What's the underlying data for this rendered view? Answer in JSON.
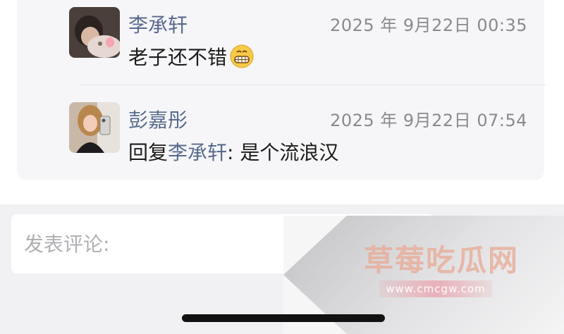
{
  "comments": [
    {
      "author": "李承轩",
      "timestamp": "2025 年 9月22日 00:35",
      "text": "老子还不错",
      "emoji": "grinning-face-icon"
    },
    {
      "author": "彭嘉彤",
      "timestamp": "2025 年 9月22日 07:54",
      "reply_prefix": "回复",
      "reply_to": "李承轩",
      "reply_separator": ": ",
      "text": "是个流浪汉"
    }
  ],
  "composer": {
    "placeholder": "发表评论:"
  },
  "watermark": {
    "title": "草莓吃瓜网",
    "url": "www.cmcgw.com"
  },
  "colors": {
    "author_name": "#5a6a8e",
    "timestamp": "#8a8a8e",
    "body_text": "#1b1b1b"
  }
}
